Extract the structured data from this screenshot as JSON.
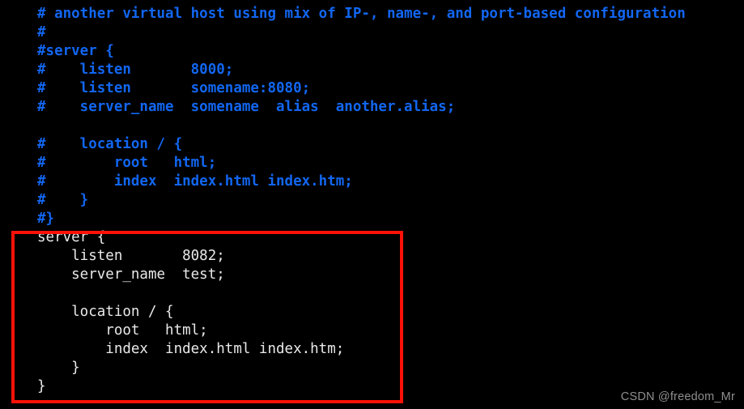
{
  "terminal": {
    "background_color": "#000000",
    "comment_color": "#1266f1",
    "code_color": "#e9e9ea",
    "highlight_color": "#fb1107",
    "watermark_color": "#8e8e8e"
  },
  "code_lines": [
    {
      "kind": "comment",
      "text": "# another virtual host using mix of IP-, name-, and port-based configuration"
    },
    {
      "kind": "comment",
      "text": "#"
    },
    {
      "kind": "comment",
      "text": "#server {"
    },
    {
      "kind": "comment",
      "text": "#    listen       8000;"
    },
    {
      "kind": "comment",
      "text": "#    listen       somename:8080;"
    },
    {
      "kind": "comment",
      "text": "#    server_name  somename  alias  another.alias;"
    },
    {
      "kind": "blank",
      "text": " "
    },
    {
      "kind": "comment",
      "text": "#    location / {"
    },
    {
      "kind": "comment",
      "text": "#        root   html;"
    },
    {
      "kind": "comment",
      "text": "#        index  index.html index.htm;"
    },
    {
      "kind": "comment",
      "text": "#    }"
    },
    {
      "kind": "comment",
      "text": "#}"
    },
    {
      "kind": "code",
      "text": "server {"
    },
    {
      "kind": "code",
      "text": "    listen       8082;"
    },
    {
      "kind": "code",
      "text": "    server_name  test;"
    },
    {
      "kind": "blank",
      "text": " "
    },
    {
      "kind": "code",
      "text": "    location / {"
    },
    {
      "kind": "code",
      "text": "        root   html;"
    },
    {
      "kind": "code",
      "text": "        index  index.html index.htm;"
    },
    {
      "kind": "code",
      "text": "    }"
    },
    {
      "kind": "code",
      "text": "}"
    }
  ],
  "highlight": {
    "label": "server-block-highlight"
  },
  "watermark": {
    "text": "CSDN @freedom_Mr"
  }
}
